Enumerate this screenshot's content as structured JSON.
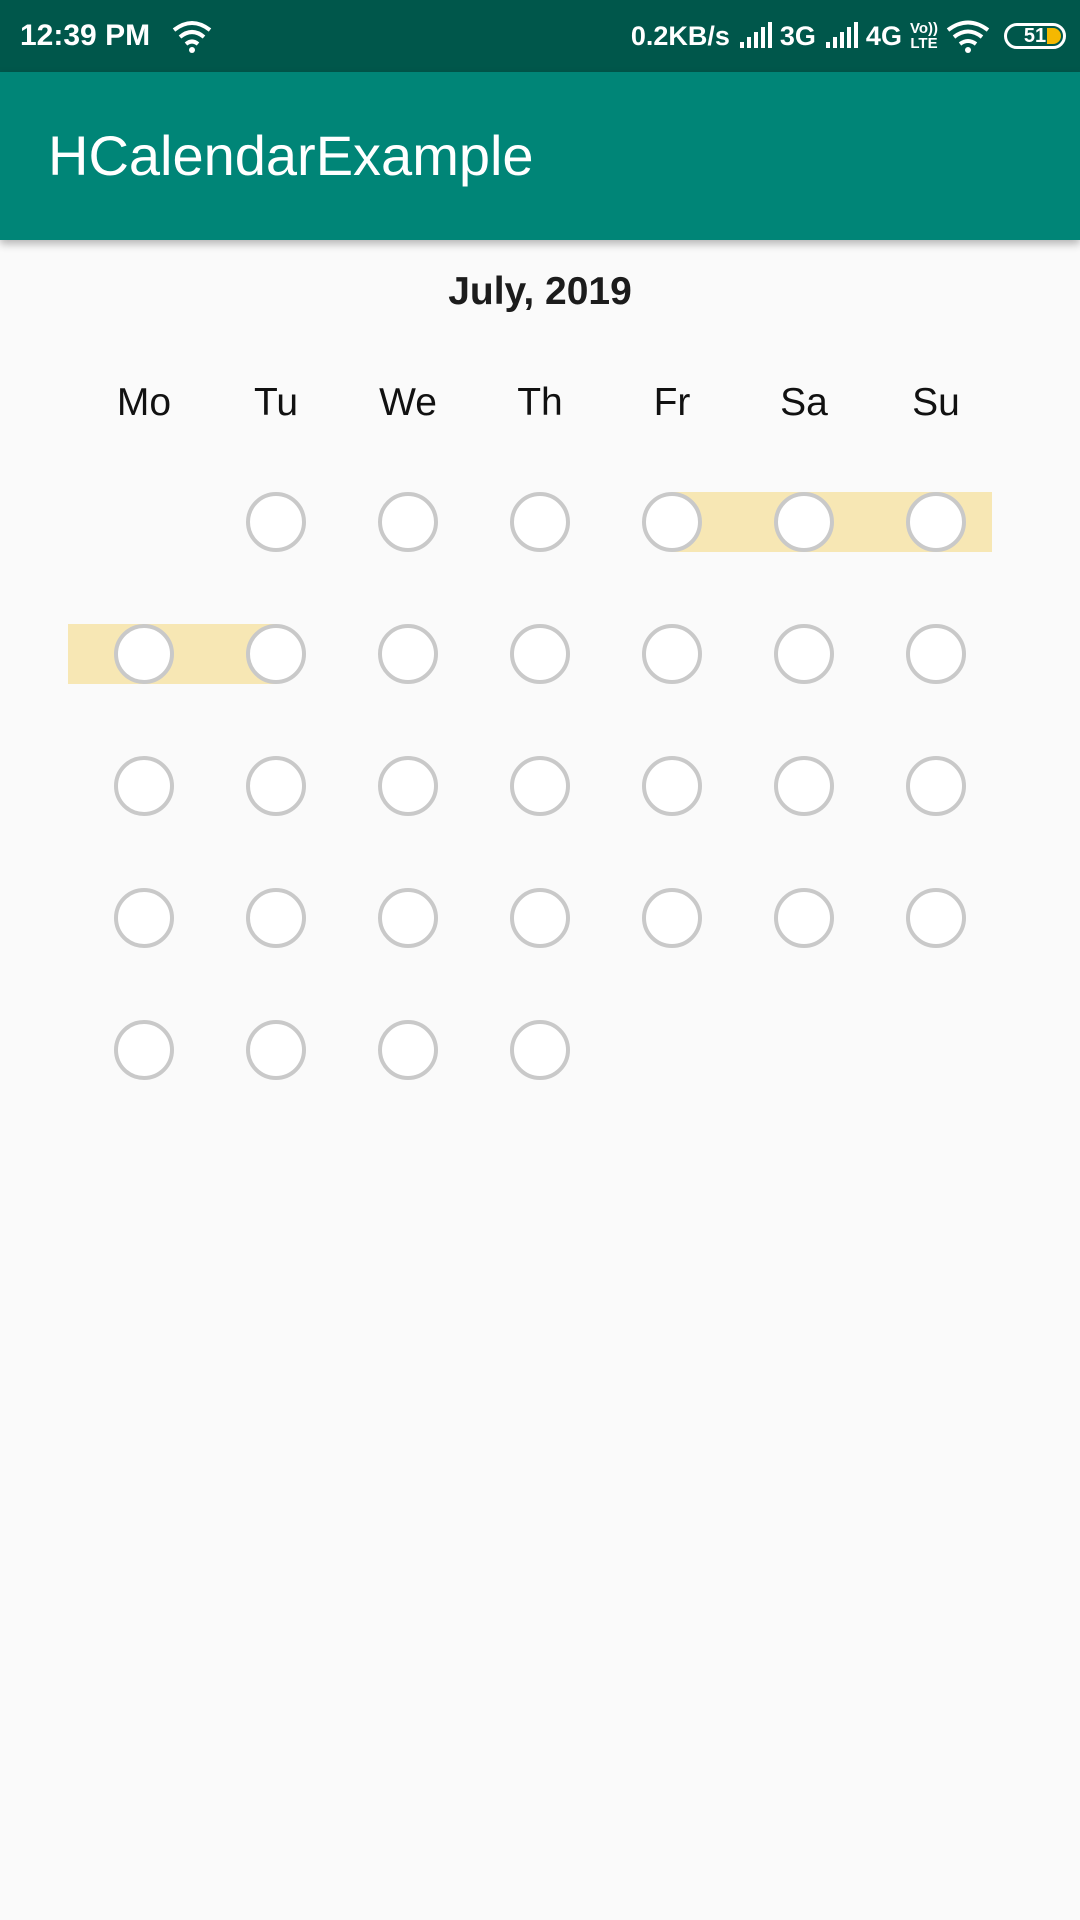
{
  "status_bar": {
    "time": "12:39 PM",
    "speed": "0.2KB/s",
    "net1": "3G",
    "net2": "4G",
    "volte_top": "Vo))",
    "volte_bottom": "LTE",
    "battery": "51",
    "icons": [
      "wifi-icon",
      "signal-icon",
      "signal-icon",
      "wifi-icon",
      "battery-icon"
    ]
  },
  "app_bar": {
    "title": "HCalendarExample",
    "color": "#008577"
  },
  "calendar": {
    "month_title": "July, 2019",
    "weekdays": [
      "Mo",
      "Tu",
      "We",
      "Th",
      "Fr",
      "Sa",
      "Su"
    ],
    "highlight_color": "#f7e7b4",
    "weeks": [
      [
        {
          "empty": true,
          "band": "none"
        },
        {
          "empty": false,
          "band": "none"
        },
        {
          "empty": false,
          "band": "none"
        },
        {
          "empty": false,
          "band": "none"
        },
        {
          "empty": false,
          "band": "start"
        },
        {
          "empty": false,
          "band": "middle"
        },
        {
          "empty": false,
          "band": "end-extend"
        }
      ],
      [
        {
          "empty": false,
          "band": "start-extend"
        },
        {
          "empty": false,
          "band": "end"
        },
        {
          "empty": false,
          "band": "none"
        },
        {
          "empty": false,
          "band": "none"
        },
        {
          "empty": false,
          "band": "none"
        },
        {
          "empty": false,
          "band": "none"
        },
        {
          "empty": false,
          "band": "none"
        }
      ],
      [
        {
          "empty": false,
          "band": "none"
        },
        {
          "empty": false,
          "band": "none"
        },
        {
          "empty": false,
          "band": "none"
        },
        {
          "empty": false,
          "band": "none"
        },
        {
          "empty": false,
          "band": "none"
        },
        {
          "empty": false,
          "band": "none"
        },
        {
          "empty": false,
          "band": "none"
        }
      ],
      [
        {
          "empty": false,
          "band": "none"
        },
        {
          "empty": false,
          "band": "none"
        },
        {
          "empty": false,
          "band": "none"
        },
        {
          "empty": false,
          "band": "none"
        },
        {
          "empty": false,
          "band": "none"
        },
        {
          "empty": false,
          "band": "none"
        },
        {
          "empty": false,
          "band": "none"
        }
      ],
      [
        {
          "empty": false,
          "band": "none"
        },
        {
          "empty": false,
          "band": "none"
        },
        {
          "empty": false,
          "band": "none"
        },
        {
          "empty": false,
          "band": "none"
        },
        {
          "empty": true,
          "band": "none"
        },
        {
          "empty": true,
          "band": "none"
        },
        {
          "empty": true,
          "band": "none"
        }
      ]
    ]
  }
}
